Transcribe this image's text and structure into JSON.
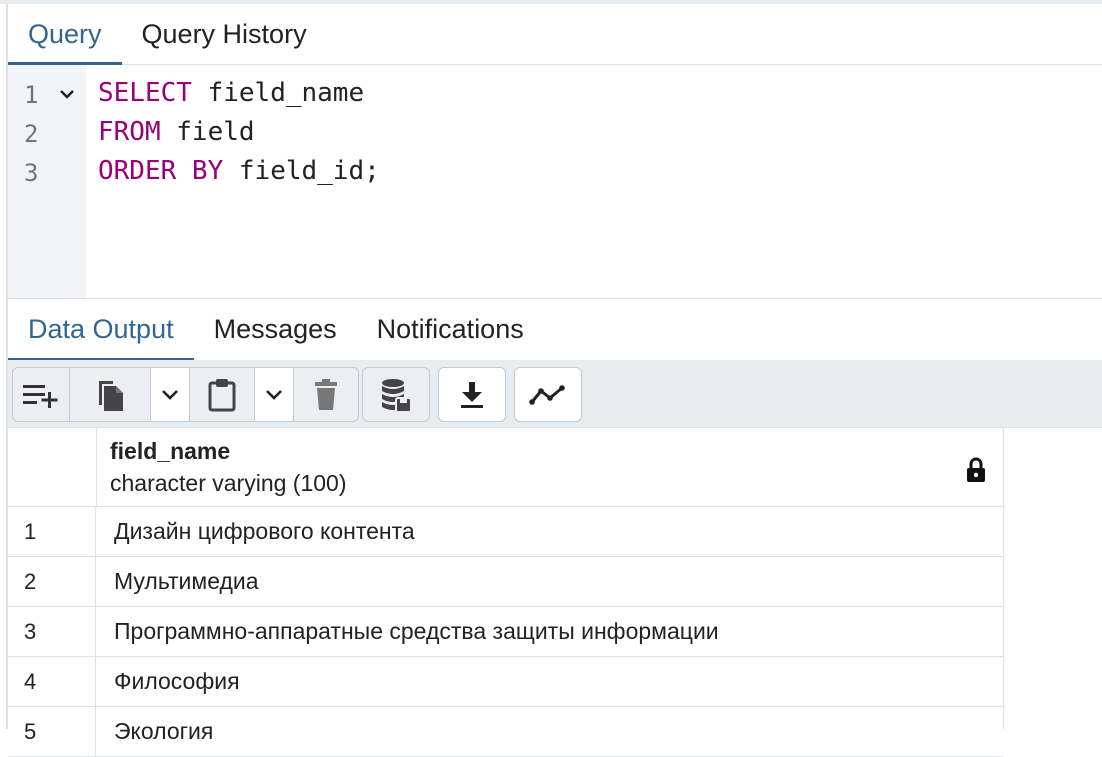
{
  "query_tabs": [
    {
      "label": "Query",
      "active": true
    },
    {
      "label": "Query History",
      "active": false
    }
  ],
  "editor": {
    "line_numbers": [
      "1",
      "2",
      "3"
    ],
    "lines": [
      {
        "keyword": "SELECT",
        "rest": " field_name"
      },
      {
        "keyword": "FROM",
        "rest": " field"
      },
      {
        "keyword": "ORDER BY",
        "rest": " field_id;"
      }
    ]
  },
  "output_tabs": [
    {
      "label": "Data Output",
      "active": true
    },
    {
      "label": "Messages",
      "active": false
    },
    {
      "label": "Notifications",
      "active": false
    }
  ],
  "toolbar": {
    "icons": [
      "add-row-icon",
      "copy-icon",
      "chevron-down-icon",
      "paste-icon",
      "chevron-down-icon",
      "delete-icon",
      "save-data-icon",
      "download-icon",
      "graph-icon"
    ]
  },
  "grid": {
    "column": {
      "name": "field_name",
      "type": "character varying (100)",
      "icon": "lock-icon"
    },
    "rows": [
      {
        "num": "1",
        "value": "Дизайн цифрового контента"
      },
      {
        "num": "2",
        "value": "Мультимедиа"
      },
      {
        "num": "3",
        "value": "Программно-аппаратные средства защиты информации"
      },
      {
        "num": "4",
        "value": "Философия"
      },
      {
        "num": "5",
        "value": "Экология"
      }
    ]
  },
  "colors": {
    "accent": "#326690",
    "keyword": "#990077"
  }
}
